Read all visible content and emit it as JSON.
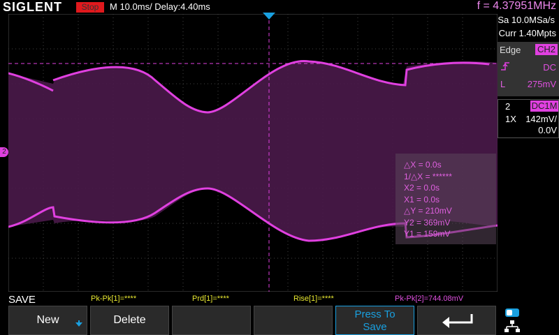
{
  "header": {
    "brand": "SIGLENT",
    "run_state": "Stop",
    "timebase": "M 10.0ms/ Delay:4.40ms",
    "frequency": "f = 4.37951MHz"
  },
  "acquisition": {
    "sample_rate": "Sa 10.0MSa/s",
    "memory_depth": "Curr 1.40Mpts"
  },
  "trigger": {
    "type": "Edge",
    "source": "CH2",
    "coupling": "DC",
    "level_label": "L",
    "level": "275mV"
  },
  "channel": {
    "number": "2",
    "coupling": "DC1M",
    "probe": "1X",
    "scale": "142mV/",
    "offset": "0.0V"
  },
  "cursors": {
    "lines": [
      "△X = 0.0s",
      "1/△X = ******",
      "X2 = 0.0s",
      "X1 = 0.0s",
      "△Y = 210mV",
      "Y2 = 369mV",
      "Y1 = 159mV"
    ]
  },
  "measurements": {
    "save_label": "SAVE",
    "items": [
      {
        "text": "Pk-Pk[1]=****",
        "color": "#e8e830"
      },
      {
        "text": "Prd[1]=****",
        "color": "#e8e830"
      },
      {
        "text": "Rise[1]=****",
        "color": "#e8e830"
      },
      {
        "text": "Pk-Pk[2]=744.08mV",
        "color": "#e050e0"
      }
    ]
  },
  "softkeys": {
    "new_label": "New",
    "delete_label": "Delete",
    "press_to_save": "Press To\nSave"
  },
  "markers": {
    "channel_marker": "2"
  },
  "colors": {
    "ch2": "#e040e0",
    "ch1": "#e8e830",
    "trigger_marker": "#19a0e0"
  }
}
